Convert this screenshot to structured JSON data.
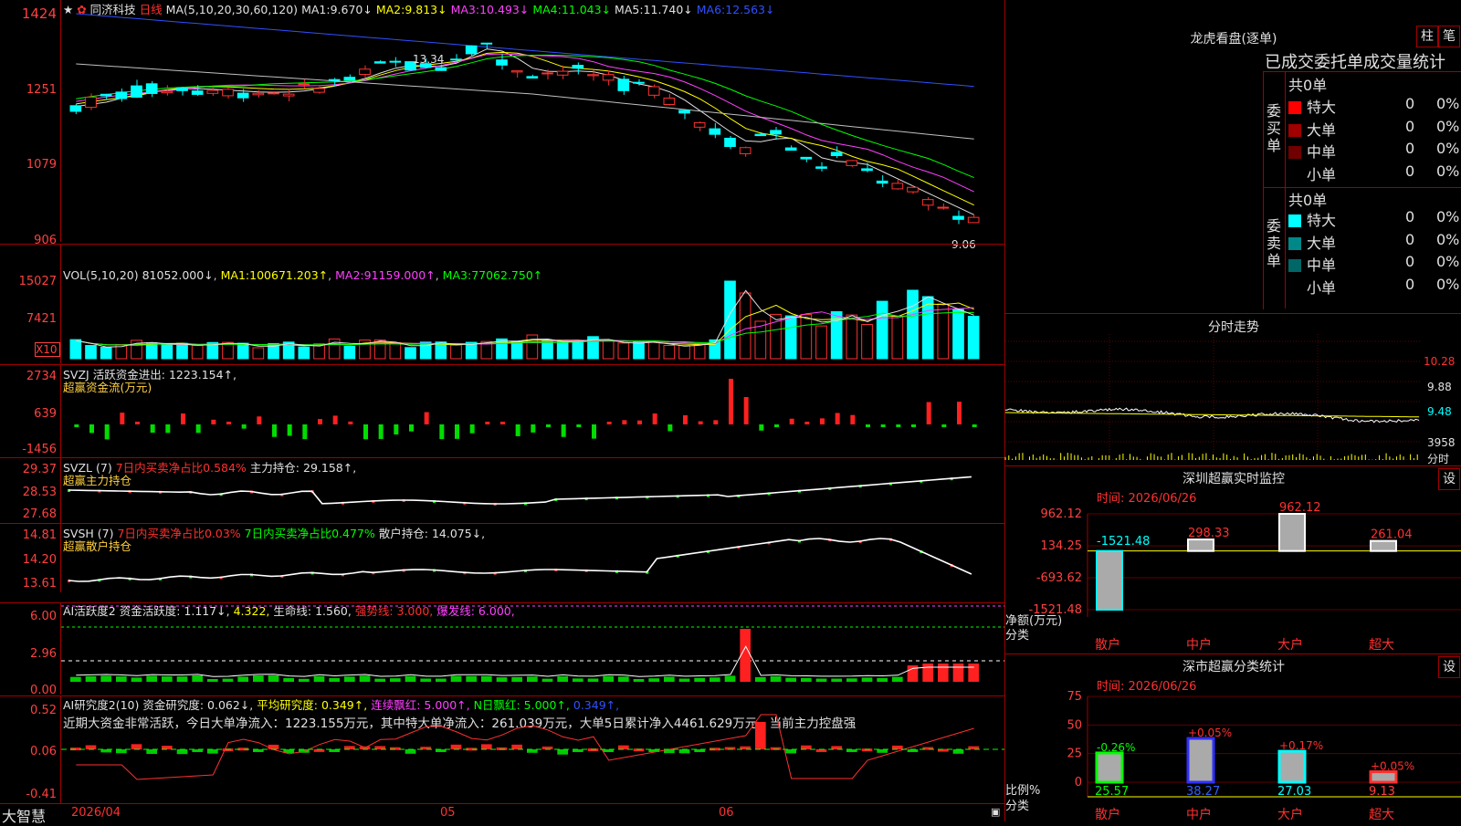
{
  "main_chart": {
    "star_icon": "★",
    "stock_name": "同济科技",
    "period": "日线",
    "ma_label": "MA(5,10,20,30,60,120)",
    "ma_values": [
      {
        "label": "MA1:",
        "value": "9.670↓",
        "color": "#e0e0e0"
      },
      {
        "label": "MA2:",
        "value": "9.813↓",
        "color": "#ffff00"
      },
      {
        "label": "MA3:",
        "value": "10.493↓",
        "color": "#ff40ff"
      },
      {
        "label": "MA4:",
        "value": "11.043↓",
        "color": "#00ff00"
      },
      {
        "label": "MA5:",
        "value": "11.740↓",
        "color": "#e0e0e0"
      },
      {
        "label": "MA6:",
        "value": "12.563↓",
        "color": "#3050ff"
      }
    ],
    "y_ticks": [
      "1424",
      "1251",
      "1079",
      "906"
    ],
    "high_marker": "13.34",
    "low_marker": "9.06"
  },
  "volume": {
    "header": "VOL(5,10,20)",
    "value": "81052.000↓",
    "ma": [
      {
        "label": "MA1:",
        "value": "100671.203↑",
        "color": "#ffff00"
      },
      {
        "label": "MA2:",
        "value": "91159.000↑",
        "color": "#ff40ff"
      },
      {
        "label": "MA3:",
        "value": "77062.750↑",
        "color": "#00ff00"
      }
    ],
    "y_ticks": [
      "15027",
      "7421"
    ],
    "unit": "X10"
  },
  "svzj": {
    "header_name": "SVZJ",
    "header_label": "活跃资金进出:",
    "header_value": "1223.154↑,",
    "subtitle": "超赢资金流(万元)",
    "y_ticks": [
      "2734",
      "639",
      "-1456"
    ]
  },
  "svzl": {
    "header_name": "SVZL (7)",
    "pct_label": "7日内买卖净占比0.584%",
    "hold_label": "主力持仓:",
    "hold_value": "29.158↑,",
    "subtitle": "超赢主力持仓",
    "y_ticks": [
      "29.37",
      "28.53",
      "27.68"
    ]
  },
  "svsh": {
    "header_name": "SVSH (7)",
    "pct1": "7日内买卖净占比0.03%",
    "pct2": "7日内买卖净占比0.477%",
    "hold_label": "散户持仓:",
    "hold_value": "14.075↓,",
    "subtitle": "超赢散户持仓",
    "y_ticks": [
      "14.81",
      "14.20",
      "13.61"
    ]
  },
  "ai_active": {
    "header": "AI活跃度2",
    "label1": "资金活跃度:",
    "value1": "1.117↓,",
    "value2": "4.322,",
    "label3": "生命线:",
    "value3": "1.560,",
    "strong": "强势线: 3.000,",
    "burst": "爆发线: 6.000,",
    "y_ticks": [
      "6.00",
      "2.96",
      "0.00"
    ]
  },
  "ai_research": {
    "header": "AI研究度2(10)",
    "label1": "资金研究度:",
    "value1": "0.062↓,",
    "label2": "平均研究度:",
    "value2": "0.349↑,",
    "label3": "连续飘红:",
    "value3": "5.000↑,",
    "label4": "N日飘红:",
    "value4": "5.000↑,",
    "value5": "0.349↑,",
    "commentary": "近期大资金非常活跃，今日大单净流入：1223.155万元，其中特大单净流入：261.039万元，大单5日累计净入4461.629万元，当前主力控盘强",
    "y_ticks": [
      "0.52",
      "0.06",
      "-0.41"
    ]
  },
  "x_axis": {
    "labels": [
      "2026/04",
      "05",
      "06"
    ]
  },
  "brand": "大智慧",
  "right": {
    "dragon_title": "龙虎看盘(逐单)",
    "btn_column": "柱",
    "btn_pen": "笔",
    "stats_title": "已成交委托单成交量统计",
    "buy_side": {
      "vertical_label": "委买单",
      "total": "共0单",
      "rows": [
        {
          "label": "特大",
          "count": "0",
          "pct": "0%",
          "color": "#ff0000"
        },
        {
          "label": "大单",
          "count": "0",
          "pct": "0%",
          "color": "#a00000"
        },
        {
          "label": "中单",
          "count": "0",
          "pct": "0%",
          "color": "#700000"
        },
        {
          "label": "小单",
          "count": "0",
          "pct": "0%",
          "color": "#000000"
        }
      ]
    },
    "sell_side": {
      "vertical_label": "委卖单",
      "total": "共0单",
      "rows": [
        {
          "label": "特大",
          "count": "0",
          "pct": "0%",
          "color": "#00ffff"
        },
        {
          "label": "大单",
          "count": "0",
          "pct": "0%",
          "color": "#008888"
        },
        {
          "label": "中单",
          "count": "0",
          "pct": "0%",
          "color": "#006666"
        },
        {
          "label": "小单",
          "count": "0",
          "pct": "0%",
          "color": "#000000"
        }
      ]
    },
    "intraday": {
      "title": "分时走势",
      "y_ticks": [
        "10.28",
        "9.88",
        "9.48"
      ],
      "vol_label": "3958",
      "unit": "分时"
    },
    "sz_monitor": {
      "title": "深圳超赢实时监控",
      "btn": "设",
      "date_label": "时间: 2026/06/26",
      "y_ticks": [
        "962.12",
        "134.25",
        "-693.62",
        "-1521.48"
      ],
      "y_label": "净额(万元)",
      "x_label": "分类",
      "categories": [
        "散户",
        "中户",
        "大户",
        "超大"
      ],
      "values": [
        "-1521.48",
        "298.33",
        "962.12",
        "261.04"
      ]
    },
    "sz_class": {
      "title": "深市超赢分类统计",
      "btn": "设",
      "date_label": "时间: 2026/06/26",
      "y_ticks": [
        "75",
        "50",
        "25",
        "0"
      ],
      "y_label": "比例%",
      "x_label": "分类",
      "categories": [
        "散户",
        "中户",
        "大户",
        "超大"
      ],
      "values": [
        "25.57",
        "38.27",
        "27.03",
        "9.13"
      ],
      "changes": [
        "-0.26%",
        "+0.05%",
        "+0.17%",
        "+0.05%"
      ]
    }
  }
}
